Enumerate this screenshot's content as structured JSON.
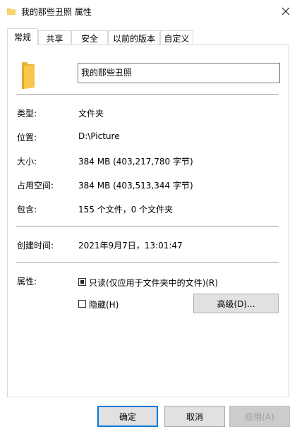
{
  "window": {
    "title": "我的那些丑照 属性",
    "close_icon": "close-icon",
    "folder_icon": "folder-icon"
  },
  "tabs": [
    {
      "label": "常规"
    },
    {
      "label": "共享"
    },
    {
      "label": "安全"
    },
    {
      "label": "以前的版本"
    },
    {
      "label": "自定义"
    }
  ],
  "general": {
    "name_value": "我的那些丑照",
    "type_label": "类型:",
    "type_value": "文件夹",
    "location_label": "位置:",
    "location_value": "D:\\Picture",
    "size_label": "大小:",
    "size_value": "384 MB (403,217,780 字节)",
    "disk_size_label": "占用空间:",
    "disk_size_value": "384 MB (403,513,344 字节)",
    "contains_label": "包含:",
    "contains_value": "155 个文件，0 个文件夹",
    "created_label": "创建时间:",
    "created_value": "2021年9月7日，13:01:47",
    "attributes_label": "属性:",
    "readonly_label": "只读(仅应用于文件夹中的文件)(R)",
    "readonly_state": "indeterminate",
    "hidden_label": "隐藏(H)",
    "hidden_checked": false,
    "advanced_button": "高级(D)..."
  },
  "footer": {
    "ok": "确定",
    "cancel": "取消",
    "apply": "应用(A)"
  },
  "colors": {
    "folder_yellow": "#f8c74a",
    "focus_blue": "#0078d7"
  }
}
